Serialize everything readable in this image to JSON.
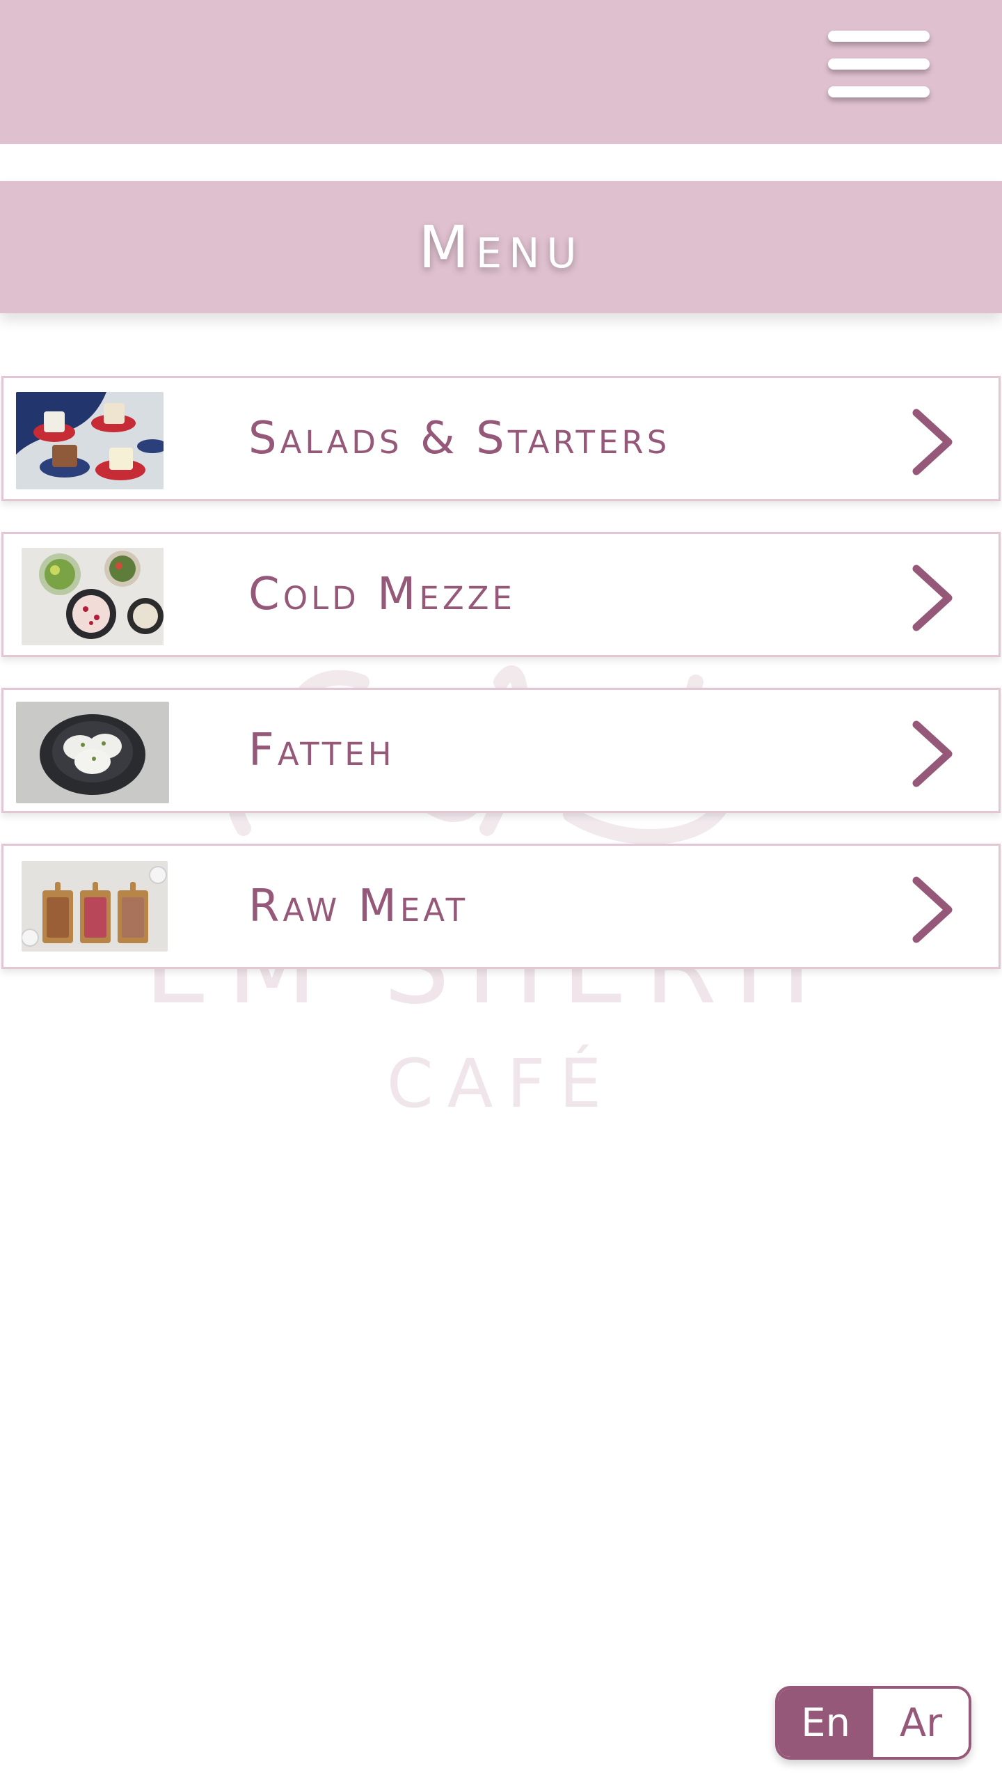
{
  "header": {
    "menu_icon": "hamburger-icon"
  },
  "banner": {
    "title": "Menu"
  },
  "watermark": {
    "logo_text": "EM SHERIF",
    "sub_text": "CAFÉ"
  },
  "categories": [
    {
      "label": "Salads & Starters",
      "thumb": "desserts-table-photo",
      "icon": "chevron-right-icon"
    },
    {
      "label": "Cold Mezze",
      "thumb": "mezze-plates-photo",
      "icon": "chevron-right-icon"
    },
    {
      "label": "Fatteh",
      "thumb": "fatteh-bowl-photo",
      "icon": "chevron-right-icon"
    },
    {
      "label": "Raw Meat",
      "thumb": "raw-meat-boards-photo",
      "icon": "chevron-right-icon"
    }
  ],
  "language": {
    "en": "En",
    "ar": "Ar",
    "selected": "En"
  },
  "colors": {
    "brand_light": "#dfc0cf",
    "brand_dark": "#955878",
    "border": "#e2c6d3"
  }
}
